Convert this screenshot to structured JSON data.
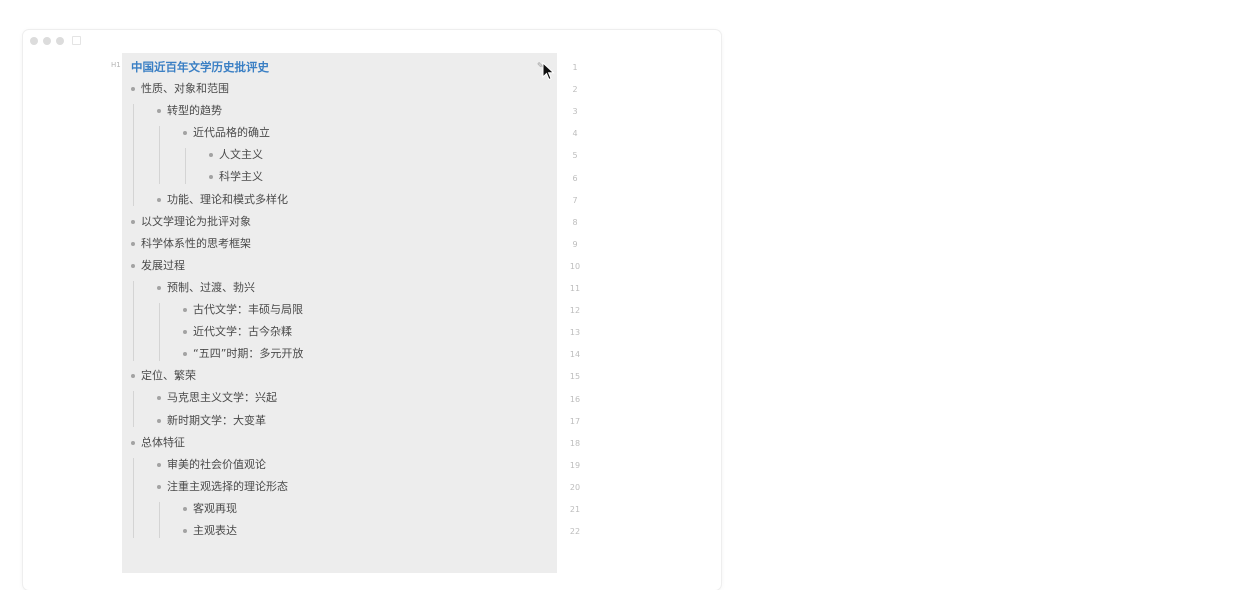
{
  "document": {
    "heading_marker": "H1",
    "title": "中国近百年文学历史批评史",
    "rows": [
      {
        "text": "性质、对象和范围",
        "level": 0
      },
      {
        "text": "转型的趋势",
        "level": 1
      },
      {
        "text": "近代品格的确立",
        "level": 2
      },
      {
        "text": "人文主义",
        "level": 3
      },
      {
        "text": "科学主义",
        "level": 3
      },
      {
        "text": "功能、理论和模式多样化",
        "level": 1
      },
      {
        "text": "以文学理论为批评对象",
        "level": 0
      },
      {
        "text": "科学体系性的思考框架",
        "level": 0
      },
      {
        "text": "发展过程",
        "level": 0
      },
      {
        "text": "预制、过渡、勃兴",
        "level": 1
      },
      {
        "text": "古代文学：丰硕与局限",
        "level": 2
      },
      {
        "text": "近代文学：古今杂糅",
        "level": 2
      },
      {
        "text": "“五四”时期：多元开放",
        "level": 2
      },
      {
        "text": "定位、繁荣",
        "level": 0
      },
      {
        "text": "马克思主义文学：兴起",
        "level": 1
      },
      {
        "text": "新时期文学：大变革",
        "level": 1
      },
      {
        "text": "总体特征",
        "level": 0
      },
      {
        "text": "审美的社会价值观论",
        "level": 1
      },
      {
        "text": "注重主观选择的理论形态",
        "level": 1
      },
      {
        "text": "客观再现",
        "level": 2
      },
      {
        "text": "主观表达",
        "level": 2
      }
    ]
  },
  "gutter": {
    "line_numbers": [
      "1",
      "2",
      "3",
      "4",
      "5",
      "6",
      "7",
      "8",
      "9",
      "10",
      "11",
      "12",
      "13",
      "14",
      "15",
      "16",
      "17",
      "18",
      "19",
      "20",
      "21",
      "22"
    ]
  },
  "icons": {
    "edit": "pencil-icon",
    "cursor": "mouse-pointer-icon"
  },
  "colors": {
    "title": "#3a7fc4",
    "editor_bg": "#ededed",
    "text": "#4a4a4a"
  }
}
